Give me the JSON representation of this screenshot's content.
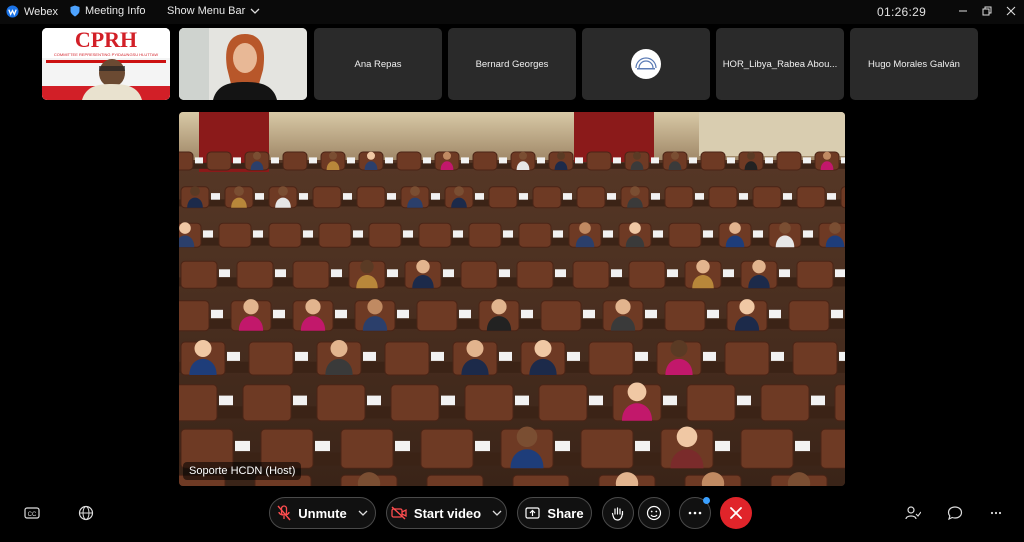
{
  "titlebar": {
    "app_name": "Webex",
    "meeting_info": "Meeting Info",
    "show_menu_bar": "Show Menu Bar",
    "clock": "01:26:29"
  },
  "participants": [
    {
      "name": "",
      "kind": "video-cprh"
    },
    {
      "name": "",
      "kind": "video-woman"
    },
    {
      "name": "Ana Repas",
      "kind": "name"
    },
    {
      "name": "Bernard Georges",
      "kind": "name"
    },
    {
      "name": "",
      "kind": "logo"
    },
    {
      "name": "HOR_Libya_Rabea Abou...",
      "kind": "name"
    },
    {
      "name": "Hugo Morales Galván",
      "kind": "name"
    }
  ],
  "cprh_banner": {
    "acronym": "CPRH",
    "subtitle": "COMMITTEE REPRESENTING PYIDAUNGSU HLUTTAW"
  },
  "main_video": {
    "host_label": "Soporte HCDN (Host)"
  },
  "controls": {
    "unmute": "Unmute",
    "start_video": "Start video",
    "share": "Share"
  },
  "colors": {
    "background": "#000000",
    "tile": "#2a2a2a",
    "leave": "#e0242a",
    "notification": "#3aa0ff"
  }
}
